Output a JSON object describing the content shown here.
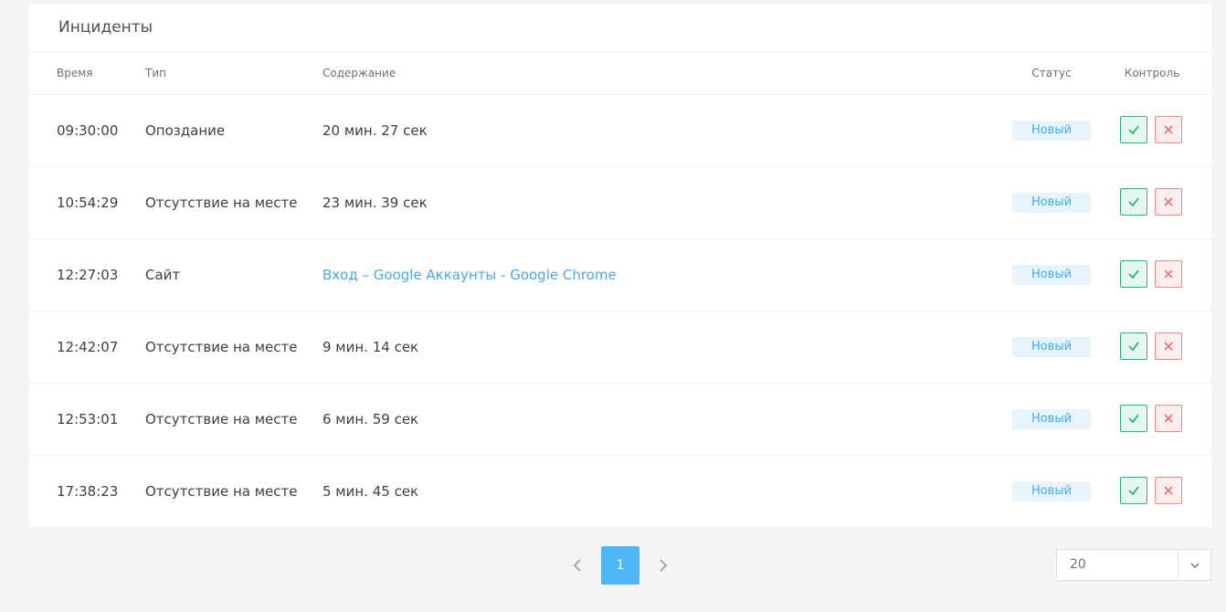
{
  "panel": {
    "title": "Инциденты"
  },
  "table": {
    "headers": {
      "time": "Время",
      "type": "Тип",
      "content": "Содержание",
      "status": "Статус",
      "control": "Контроль"
    },
    "rows": [
      {
        "time": "09:30:00",
        "type": "Опоздание",
        "content": "20 мин. 27 сек",
        "content_is_link": false,
        "status": "Новый"
      },
      {
        "time": "10:54:29",
        "type": "Отсутствие на месте",
        "content": "23 мин. 39 сек",
        "content_is_link": false,
        "status": "Новый"
      },
      {
        "time": "12:27:03",
        "type": "Сайт",
        "content": "Вход – Google Аккаунты - Google Chrome",
        "content_is_link": true,
        "status": "Новый"
      },
      {
        "time": "12:42:07",
        "type": "Отсутствие на месте",
        "content": "9 мин. 14 сек",
        "content_is_link": false,
        "status": "Новый"
      },
      {
        "time": "12:53:01",
        "type": "Отсутствие на месте",
        "content": "6 мин. 59 сек",
        "content_is_link": false,
        "status": "Новый"
      },
      {
        "time": "17:38:23",
        "type": "Отсутствие на месте",
        "content": "5 мин. 45 сек",
        "content_is_link": false,
        "status": "Новый"
      }
    ],
    "controls": {
      "approve_icon": "check-icon",
      "reject_icon": "close-icon"
    }
  },
  "pagination": {
    "current_page": "1",
    "prev_icon": "chevron-left-icon",
    "next_icon": "chevron-right-icon",
    "page_size": "20",
    "page_size_icon": "chevron-down-icon"
  },
  "colors": {
    "accent": "#4db6f5",
    "link": "#4aa8e8",
    "status_badge_bg": "#e8f4fd",
    "approve": "#2bb57a",
    "reject": "#f08a8a",
    "page_bg": "#f3f4f6"
  }
}
